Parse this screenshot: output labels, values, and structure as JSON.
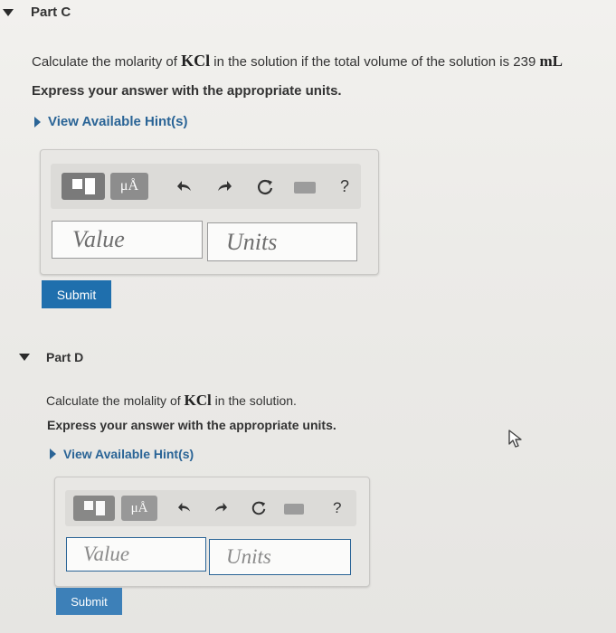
{
  "part_c": {
    "title": "Part C",
    "question_prefix": "Calculate the molarity of",
    "compound": "KCl",
    "question_suffix": "in the solution if the total volume of the solution is 239",
    "volume_unit": "mL",
    "instruction": "Express your answer with the appropriate units.",
    "hint_label": "View Available Hint(s)",
    "value_placeholder": "Value",
    "units_placeholder": "Units",
    "submit_label": "Submit"
  },
  "part_d": {
    "title": "Part D",
    "question_prefix": "Calculate the molality of",
    "compound": "KCl",
    "question_suffix": "in the solution.",
    "instruction": "Express your answer with the appropriate units.",
    "hint_label": "View Available Hint(s)",
    "value_placeholder": "Value",
    "units_placeholder": "Units",
    "submit_label": "Submit"
  },
  "toolbar": {
    "units_symbol": "μÅ",
    "help_symbol": "?",
    "icons": [
      "templates-icon",
      "units-icon",
      "undo-icon",
      "redo-icon",
      "reset-icon",
      "keyboard-icon",
      "help-icon"
    ]
  },
  "colors": {
    "link": "#2a6496",
    "submit_bg": "#1f6fad"
  }
}
